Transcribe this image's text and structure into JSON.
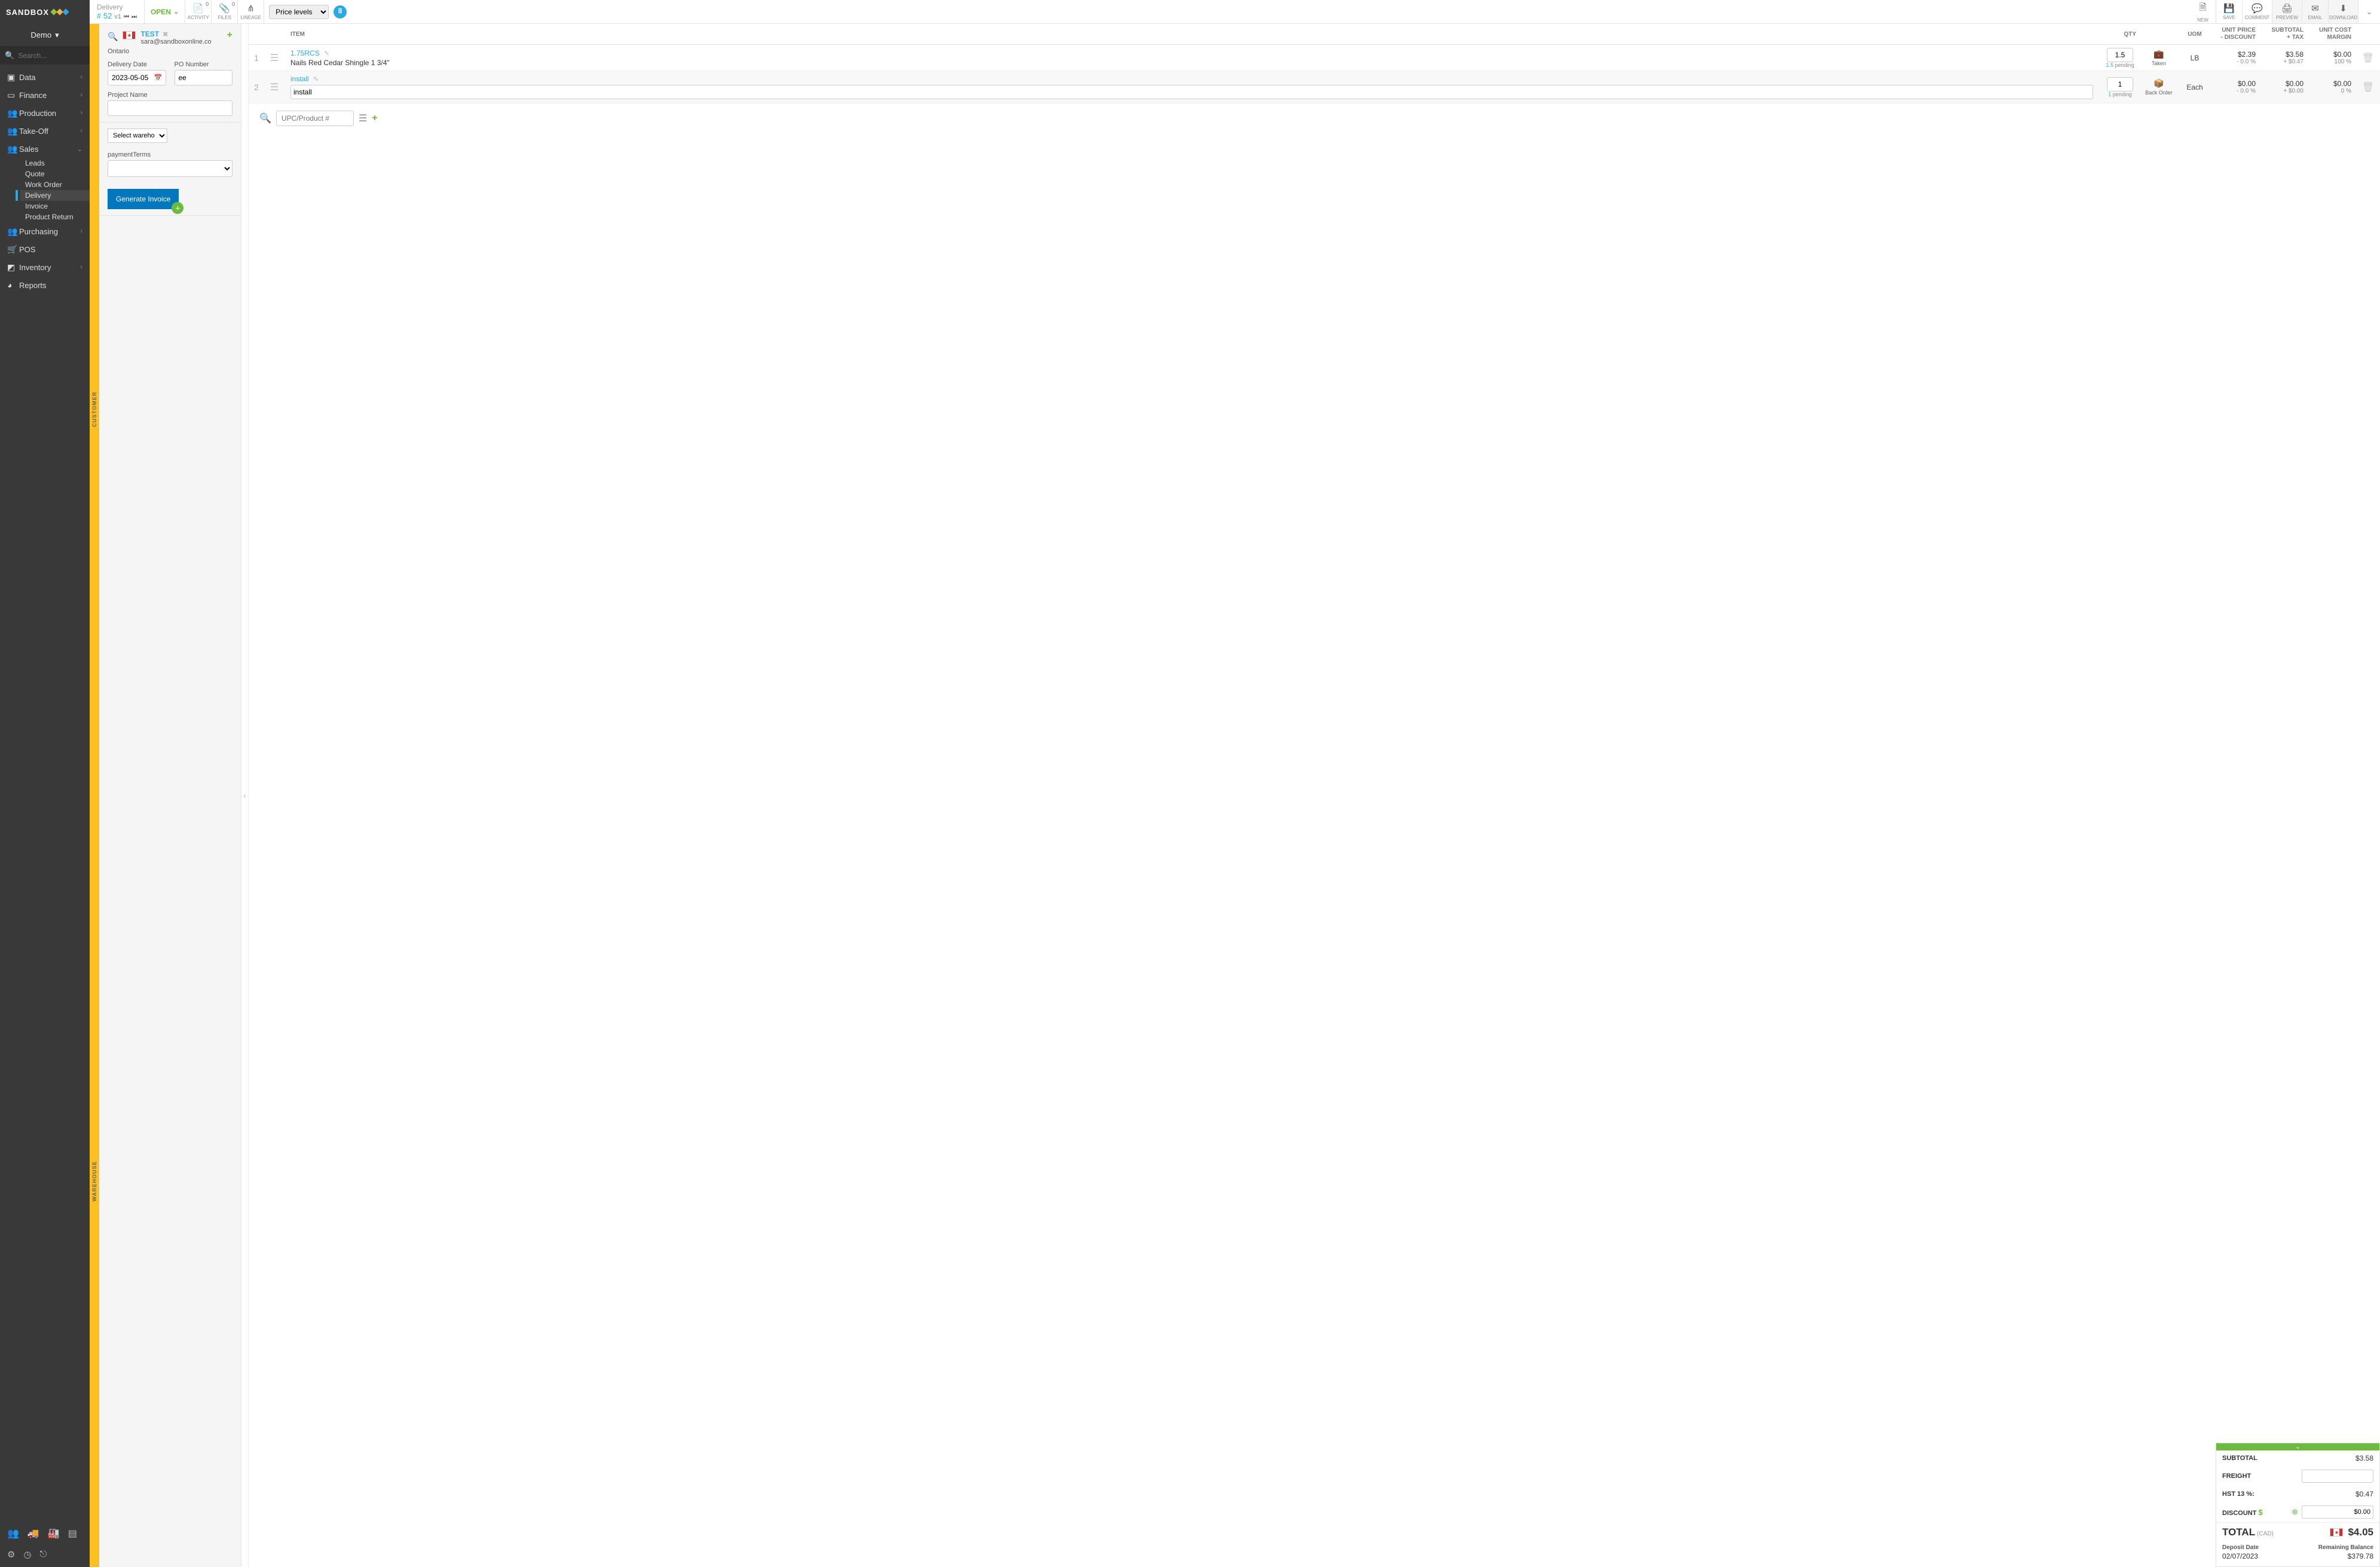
{
  "brand": "SANDBOX",
  "tenant": "Demo",
  "search_placeholder": "Search...",
  "nav": {
    "data": "Data",
    "finance": "Finance",
    "production": "Production",
    "takeoff": "Take-Off",
    "sales": "Sales",
    "purchasing": "Purchasing",
    "pos": "POS",
    "inventory": "Inventory",
    "reports": "Reports",
    "sales_sub": {
      "leads": "Leads",
      "quote": "Quote",
      "workorder": "Work Order",
      "delivery": "Delivery",
      "invoice": "Invoice",
      "return": "Product Return"
    }
  },
  "doc": {
    "type": "Delivery",
    "number": "# 52",
    "version": "v1",
    "status": "OPEN"
  },
  "toolbar": {
    "activity": "ACTIVITY",
    "activity_count": "0",
    "files": "FILES",
    "files_count": "0",
    "lineage": "LINEAGE",
    "new": "NEW",
    "save": "SAVE",
    "comment": "COMMENT",
    "preview": "PREVIEW",
    "email": "EMAIL",
    "download": "DOWNLOAD",
    "price_levels": "Price levels"
  },
  "vtabs": {
    "customer": "CUSTOMER",
    "warehouse": "WAREHOUSE"
  },
  "customer": {
    "name": "TEST",
    "email": "sara@sandboxonline.co",
    "location": "Ontario",
    "delivery_date_label": "Delivery Date",
    "delivery_date": "2023-05-05",
    "po_label": "PO Number",
    "po": "ee",
    "project_label": "Project Name",
    "project": ""
  },
  "warehouse": {
    "select_placeholder": "Select warehouse",
    "payment_label": "paymentTerms",
    "generate": "Generate Invoice"
  },
  "headers": {
    "item": "ITEM",
    "qty": "QTY",
    "uom": "UOM",
    "price1": "UNIT PRICE",
    "price2": "- DISCOUNT",
    "sub1": "SUBTOTAL",
    "sub2": "+ TAX",
    "margin1": "UNIT COST",
    "margin2": "MARGIN"
  },
  "lines": [
    {
      "n": "1",
      "code": "1.75RCS",
      "desc": "Nails Red Cedar Shingle 1 3/4\"",
      "qty": "1.5",
      "pending_n": "1.5",
      "pending_t": " pending",
      "status_label": "Taken",
      "status_kind": "taken",
      "uom": "LB",
      "price": "$2.39",
      "price_sub": "- 0.0 %",
      "sub": "$3.58",
      "sub_sub": "+ $0.47",
      "margin": "$0.00",
      "margin_sub": "100 %"
    },
    {
      "n": "2",
      "code": "install",
      "desc": "install",
      "qty": "1",
      "pending_n": "1",
      "pending_t": " pending",
      "status_label": "Back Order",
      "status_kind": "backorder",
      "uom": "Each",
      "price": "$0.00",
      "price_sub": "- 0.0 %",
      "sub": "$0.00",
      "sub_sub": "+ $0.00",
      "margin": "$0.00",
      "margin_sub": "0 %"
    }
  ],
  "add_line_placeholder": "UPC/Product #",
  "totals": {
    "subtotal_l": "SUBTOTAL",
    "subtotal_v": "$3.58",
    "freight_l": "FREIGHT",
    "freight_v": "",
    "tax_l": "HST 13 %:",
    "tax_v": "$0.47",
    "discount_l": "DISCOUNT",
    "discount_v": "$0.00",
    "total_l": "TOTAL",
    "currency": "(CAD)",
    "total_v": "$4.05",
    "deposit_l": "Deposit Date",
    "deposit_v": "02/07/2023",
    "balance_l": "Remaining Balance",
    "balance_v": "$379.78"
  }
}
